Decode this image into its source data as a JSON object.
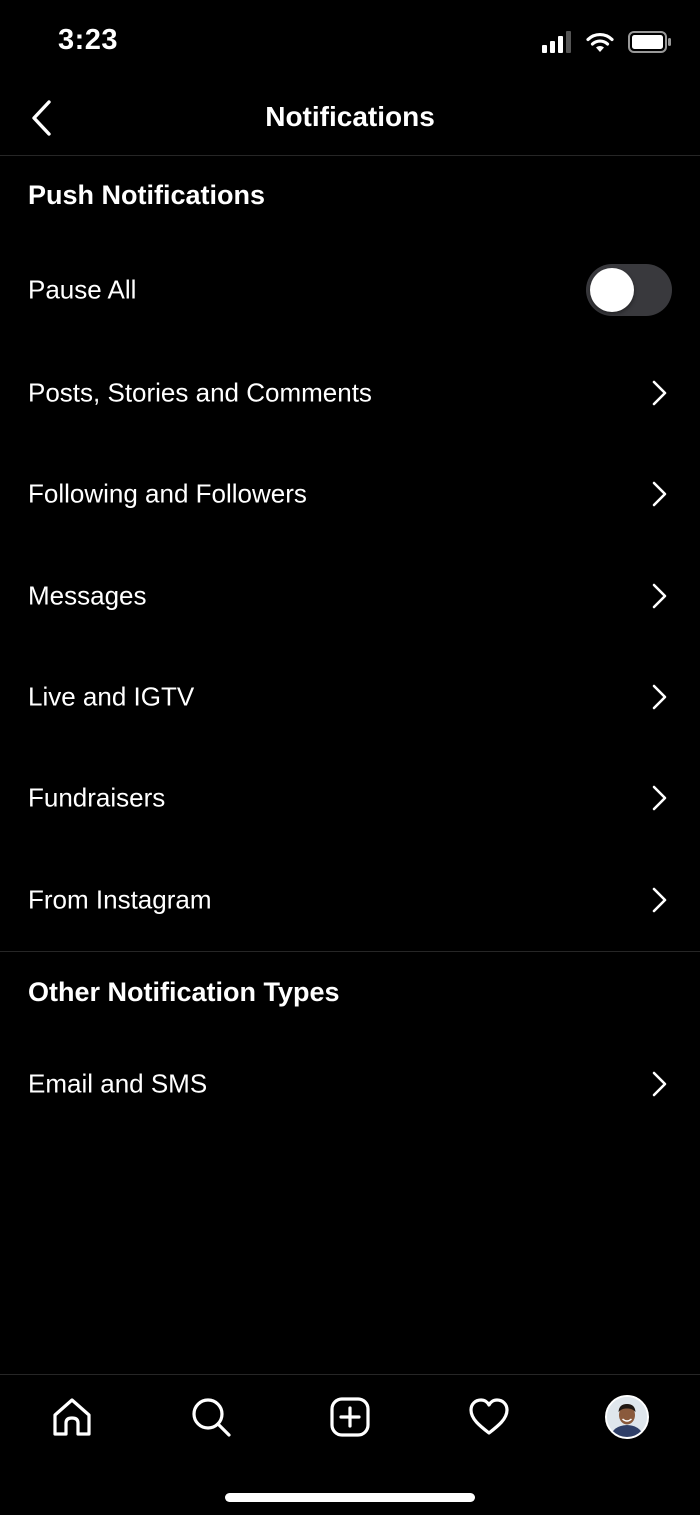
{
  "status_bar": {
    "time": "3:23",
    "icons": [
      "cellular-signal-icon",
      "wifi-icon",
      "battery-icon"
    ]
  },
  "header": {
    "back_icon": "chevron-left-icon",
    "title": "Notifications"
  },
  "push_section": {
    "title": "Push Notifications",
    "pause_all": {
      "label": "Pause All",
      "enabled": false
    },
    "items": [
      {
        "label": "Posts, Stories and Comments",
        "icon": "chevron-right-icon"
      },
      {
        "label": "Following and Followers",
        "icon": "chevron-right-icon"
      },
      {
        "label": "Messages",
        "icon": "chevron-right-icon"
      },
      {
        "label": "Live and IGTV",
        "icon": "chevron-right-icon"
      },
      {
        "label": "Fundraisers",
        "icon": "chevron-right-icon"
      },
      {
        "label": "From Instagram",
        "icon": "chevron-right-icon"
      }
    ]
  },
  "other_section": {
    "title": "Other Notification Types",
    "items": [
      {
        "label": "Email and SMS",
        "icon": "chevron-right-icon"
      }
    ]
  },
  "tab_bar": {
    "tabs": [
      {
        "name": "home",
        "icon": "home-icon"
      },
      {
        "name": "search",
        "icon": "search-icon"
      },
      {
        "name": "new-post",
        "icon": "add-post-icon"
      },
      {
        "name": "activity",
        "icon": "heart-icon"
      },
      {
        "name": "profile",
        "icon": "profile-avatar"
      }
    ]
  },
  "colors": {
    "background": "#000000",
    "text": "#ffffff",
    "divider": "#262626",
    "toggle_off": "#39393d"
  }
}
